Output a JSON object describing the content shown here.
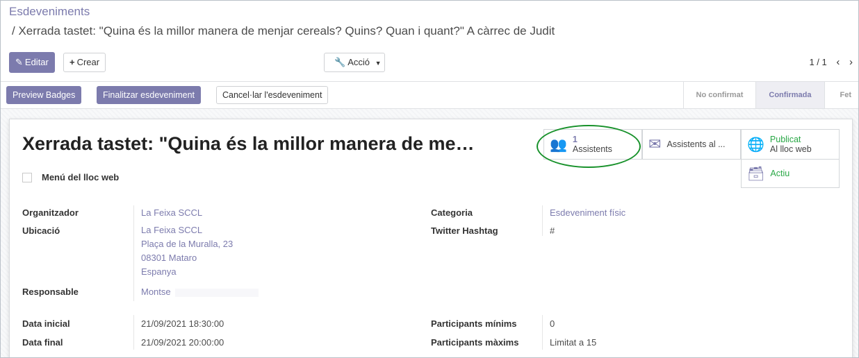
{
  "breadcrumb": {
    "parent": "Esdeveniments",
    "current": "/ Xerrada tastet: \"Quina és la millor manera de menjar cereals? Quins? Quan i quant?\" A càrrec de Judit"
  },
  "toolbar": {
    "edit_label": "Editar",
    "create_label": "Crear",
    "action_label": "Acció",
    "pager_text": "1 / 1"
  },
  "statusbar": {
    "buttons": [
      "Preview Badges",
      "Finalitzar esdeveniment",
      "Cancel·lar l'esdeveniment"
    ],
    "steps": [
      "No confirmat",
      "Confirmada",
      "Fet"
    ],
    "active_step": "Confirmada"
  },
  "record": {
    "title": "Xerrada tastet: \"Quina és la millor manera de me…",
    "website_menu_label": "Menú del lloc web"
  },
  "smart_buttons": {
    "attendees_count": "1",
    "attendees_label": "Assistents",
    "mail_label": "Assistents al ...",
    "published_label": "Publicat",
    "published_sub": "Al lloc web",
    "active_label": "Actiu"
  },
  "fields": {
    "organizer_label": "Organitzador",
    "organizer_value": "La Feixa SCCL",
    "location_label": "Ubicació",
    "location_lines": [
      "La Feixa SCCL",
      "Plaça de la Muralla, 23",
      "08301 Mataro",
      "Espanya"
    ],
    "responsible_label": "Responsable",
    "responsible_value": "Montse",
    "category_label": "Categoria",
    "category_value": "Esdeveniment físic",
    "twitter_label": "Twitter Hashtag",
    "twitter_value": "#",
    "start_label": "Data inicial",
    "start_value": "21/09/2021 18:30:00",
    "end_label": "Data final",
    "end_value": "21/09/2021 20:00:00",
    "min_label": "Participants mínims",
    "min_value": "0",
    "max_label": "Participants màxims",
    "max_value": "Limitat a 15"
  },
  "colors": {
    "accent": "#7c7bad",
    "published_green": "#28a745",
    "annotation_ring": "#17912a"
  }
}
